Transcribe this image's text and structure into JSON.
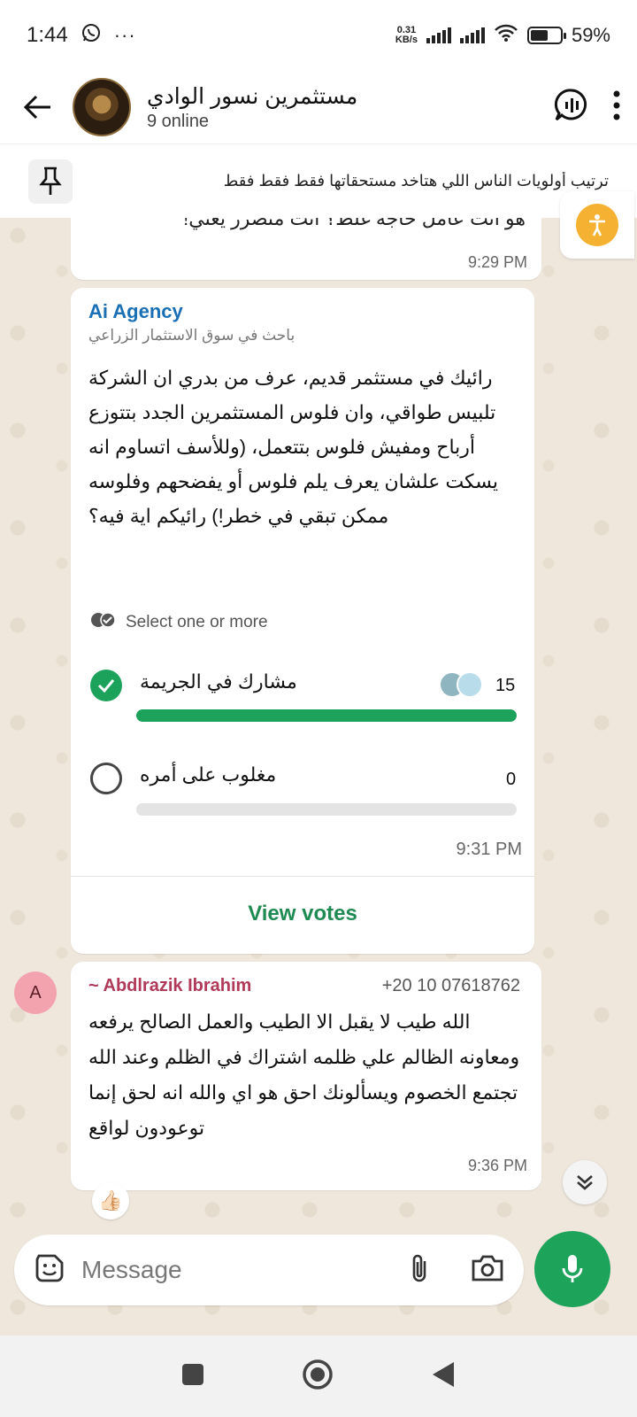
{
  "status_bar": {
    "time": "1:44",
    "net_speed_top": "0.31",
    "net_speed_bottom": "KB/s",
    "battery_percent": "59%",
    "battery_level": 0.59
  },
  "header": {
    "title": "مستثمرين نسور الوادي",
    "subtitle": "9 online"
  },
  "pinned": {
    "text": "ترتيب أولويات الناس اللي هتاخد مستحقاتها فقط فقط فقط"
  },
  "messages": {
    "prev": {
      "text": "هو انت عامل حاجة غلط؟ انت متضرر يعني!",
      "time": "9:29 PM"
    },
    "poll": {
      "sender": "Ai Agency",
      "sender_subtitle": "باحث في سوق الاستثمار الزراعي",
      "question": "رائيك في مستثمر قديم، عرف من بدري ان الشركة تلبيس طواقي، وان فلوس المستثمرين الجدد بتتوزع أرباح ومفيش فلوس بتتعمل، (وللأسف اتساوم انه يسكت علشان يعرف يلم فلوس أو يفضحهم وفلوسه ممكن تبقي في خطر!) رائيكم اية فيه؟",
      "select_hint": "Select one or more",
      "options": [
        {
          "label": "مشارك في الجريمة",
          "count": "15",
          "share": 1.0,
          "selected": true
        },
        {
          "label": "مغلوب على أمره",
          "count": "0",
          "share": 0.0,
          "selected": false
        }
      ],
      "time": "9:31 PM",
      "view_votes": "View votes"
    },
    "reply": {
      "avatar_letter": "A",
      "sender": "~ Abdlrazik Ibrahim",
      "phone": "+20 10 07618762",
      "text": "الله طيب لا يقبل الا الطيب والعمل الصالح يرفعه ومعاونه الظالم علي ظلمه اشتراك في الظلم وعند الله تجتمع الخصوم ويسألونك احق هو اي والله انه لحق إنما توعودون لواقع",
      "time": "9:36 PM",
      "reaction": "👍🏻"
    }
  },
  "composer": {
    "placeholder": "Message"
  },
  "colors": {
    "accent_green": "#1ea35a",
    "poll_sender": "#1a6fb5",
    "reply_sender": "#b03a58",
    "wallpaper": "#efe7dc"
  },
  "icons": [
    "whatsapp-icon",
    "more-dots-icon",
    "signal-icon",
    "wifi-icon",
    "battery-icon",
    "back-arrow-icon",
    "voice-chat-icon",
    "kebab-menu-icon",
    "pin-icon",
    "accessibility-icon",
    "double-check-icon",
    "check-icon",
    "chevron-double-down-icon",
    "sticker-icon",
    "attach-icon",
    "camera-icon",
    "mic-icon",
    "square-nav-icon",
    "home-nav-icon",
    "back-nav-icon"
  ]
}
